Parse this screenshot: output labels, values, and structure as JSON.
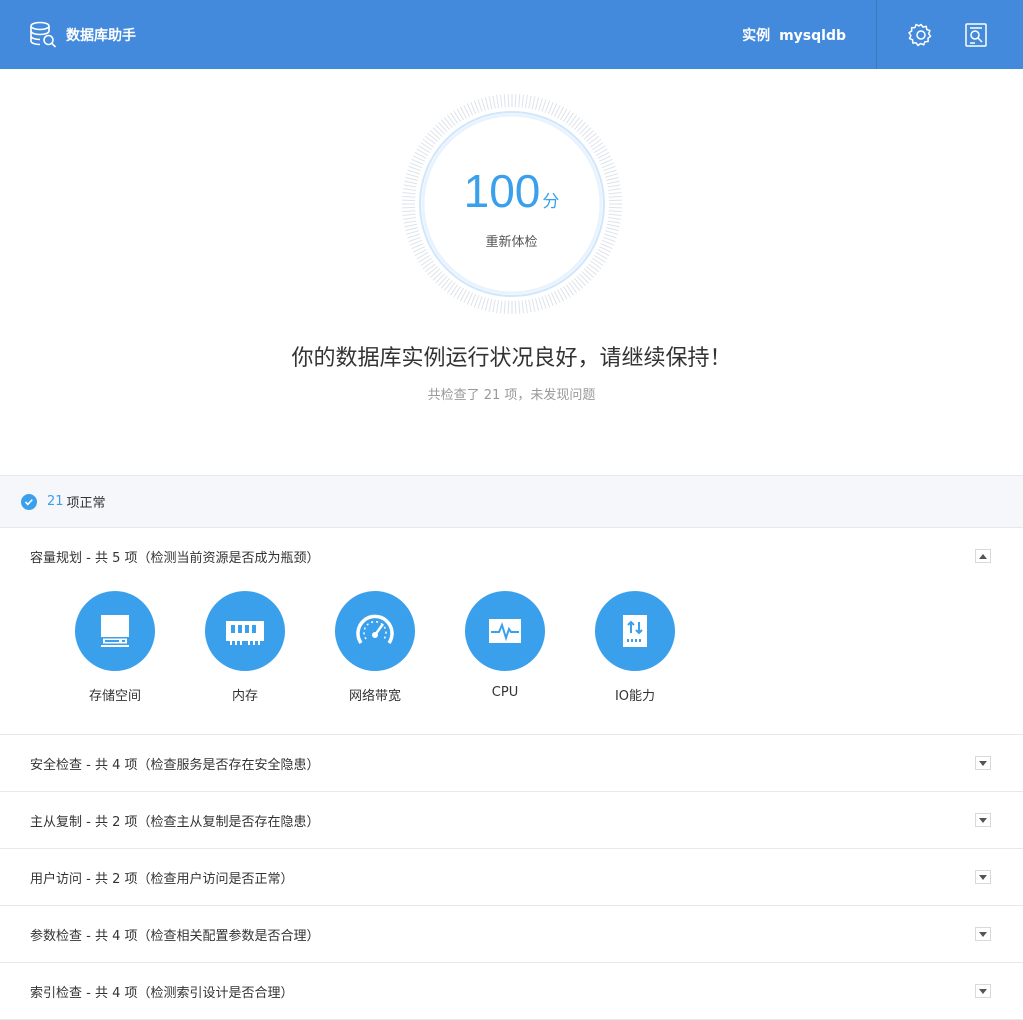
{
  "header": {
    "app_title": "数据库助手",
    "instance_label": "实例",
    "instance_name": "mysqldb"
  },
  "score": {
    "value": "100",
    "unit": "分",
    "recheck_label": "重新体检"
  },
  "summary": {
    "headline": "你的数据库实例运行状况良好，请继续保持！",
    "subline": "共检查了 21 项，未发现问题"
  },
  "normal_bar": {
    "count": "21",
    "text": "项正常"
  },
  "sections": [
    {
      "title": "容量规划 - 共 5 项（检测当前资源是否成为瓶颈）",
      "expanded": true,
      "items": [
        {
          "label": "存储空间",
          "icon": "hard-drive-icon"
        },
        {
          "label": "内存",
          "icon": "memory-icon"
        },
        {
          "label": "网络带宽",
          "icon": "speedometer-icon"
        },
        {
          "label": "CPU",
          "icon": "cpu-pulse-icon"
        },
        {
          "label": "IO能力",
          "icon": "io-transfer-icon"
        }
      ]
    },
    {
      "title": "安全检查 - 共 4 项（检查服务是否存在安全隐患）",
      "expanded": false
    },
    {
      "title": "主从复制 - 共 2 项（检查主从复制是否存在隐患）",
      "expanded": false
    },
    {
      "title": "用户访问 - 共 2 项（检查用户访问是否正常）",
      "expanded": false
    },
    {
      "title": "参数检查 - 共 4 项（检查相关配置参数是否合理）",
      "expanded": false
    },
    {
      "title": "索引检查 - 共 4 项（检测索引设计是否合理）",
      "expanded": false
    }
  ],
  "colors": {
    "header_bg": "#448adc",
    "accent": "#3ba0ec"
  }
}
